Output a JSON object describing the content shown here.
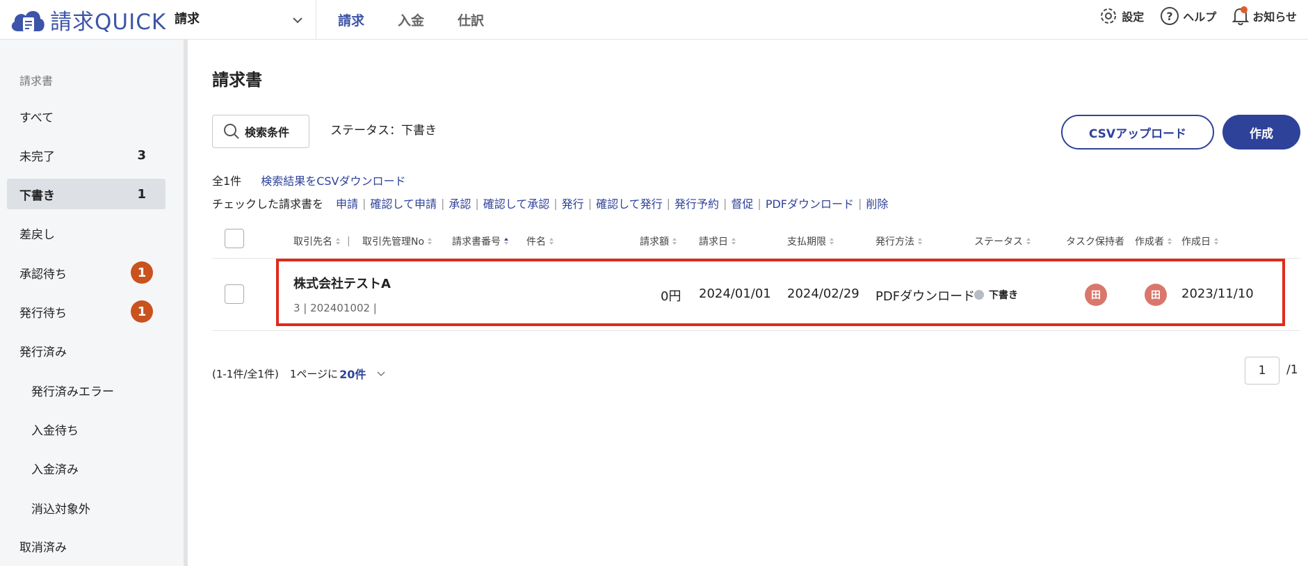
{
  "header": {
    "logo_text": "請求QUICK",
    "app_selector": "請求",
    "nav": [
      "請求",
      "入金",
      "仕訳"
    ],
    "settings": "設定",
    "help": "ヘルプ",
    "notifications": "お知らせ"
  },
  "sidebar": {
    "section_title": "請求書",
    "items": [
      {
        "label": "すべて"
      },
      {
        "label": "未完了",
        "count": "3"
      },
      {
        "label": "下書き",
        "count": "1"
      },
      {
        "label": "差戻し"
      },
      {
        "label": "承認待ち",
        "badge": "1"
      },
      {
        "label": "発行待ち",
        "badge": "1"
      },
      {
        "label": "発行済み"
      },
      {
        "label": "発行済みエラー"
      },
      {
        "label": "入金待ち"
      },
      {
        "label": "入金済み"
      },
      {
        "label": "消込対象外"
      },
      {
        "label": "取消済み"
      }
    ]
  },
  "main": {
    "title": "請求書",
    "search_button": "検索条件",
    "status_filter": "ステータス：下書き",
    "csv_upload": "CSVアップロード",
    "create": "作成",
    "total_count": "全1件",
    "csv_download": "検索結果をCSVダウンロード",
    "bulk_prefix": "チェックした請求書を",
    "bulk_actions": [
      "申請",
      "確認して申請",
      "承認",
      "確認して承認",
      "発行",
      "確認して発行",
      "発行予約",
      "督促",
      "PDFダウンロード",
      "削除"
    ],
    "columns": {
      "client": "取引先名",
      "client_no": "取引先管理No",
      "invoice_no": "請求書番号",
      "subject": "件名",
      "amount": "請求額",
      "invoice_date": "請求日",
      "due_date": "支払期限",
      "method": "発行方法",
      "status": "ステータス",
      "task_owner": "タスク保持者",
      "creator": "作成者",
      "created": "作成日"
    },
    "row": {
      "client": "株式会社テストA",
      "sub": "3 | 202401002 |",
      "amount": "0円",
      "invoice_date": "2024/01/01",
      "due_date": "2024/02/29",
      "method": "PDFダウンロード",
      "status": "下書き",
      "task_owner_avatar": "田",
      "creator_avatar": "田",
      "created": "2023/11/10"
    },
    "pager": {
      "info": "(1-1件/全1件)",
      "per_page_label": "1ページに",
      "per_page_value": "20件",
      "current_page": "1",
      "total_pages": "/1"
    }
  }
}
